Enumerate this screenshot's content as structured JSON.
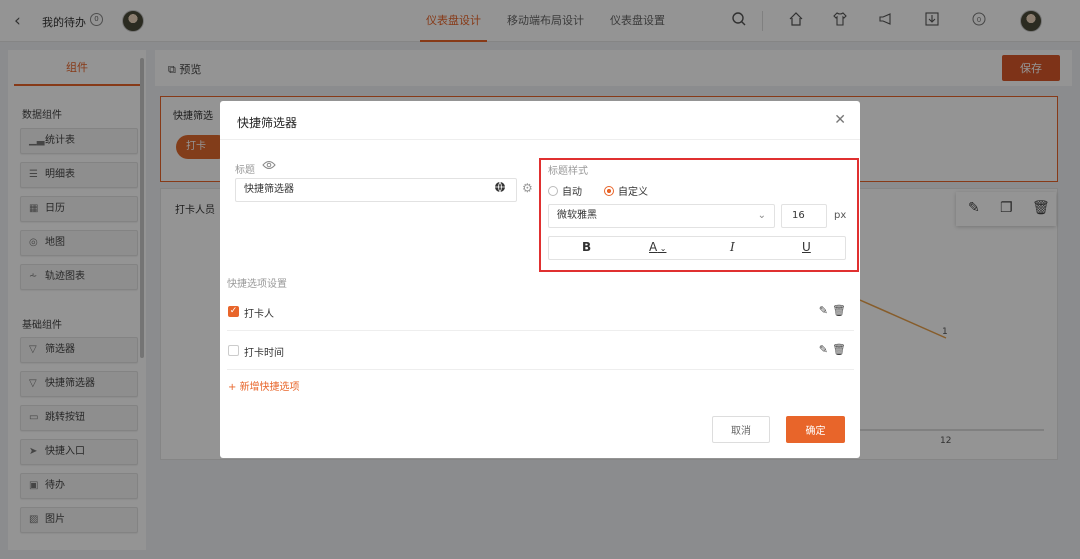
{
  "topbar": {
    "back_icon": "chevron-left-icon",
    "todo_title": "我的待办",
    "todo_badge": "0",
    "tabs": [
      "仪表盘设计",
      "移动端布局设计",
      "仪表盘设置"
    ],
    "active_tab": 0,
    "icons": [
      "search-icon",
      "home-icon",
      "shirt-icon",
      "megaphone-icon",
      "download-icon",
      "notification-badge-icon"
    ],
    "notification_badge": "0"
  },
  "left_panel": {
    "tab_label": "组件",
    "data_group_label": "数据组件",
    "data_items": [
      "统计表",
      "明细表",
      "日历",
      "地图",
      "轨迹图表"
    ],
    "basic_group_label": "基础组件",
    "basic_items": [
      "筛选器",
      "快捷筛选器",
      "跳转按钮",
      "快捷入口",
      "待办",
      "图片"
    ]
  },
  "canvas": {
    "preview_label": "预览",
    "save_label": "保存",
    "widget1_title": "快捷筛选",
    "widget1_chip": "打卡",
    "widget2_title": "打卡人员",
    "chart_value_label": "1",
    "chart_axis_label": "12"
  },
  "dialog": {
    "title": "快捷筛选器",
    "title_label": "标题",
    "title_value": "快捷筛选器",
    "style_label": "标题样式",
    "radio_auto": "自动",
    "radio_custom": "自定义",
    "radio_selected": "custom",
    "font_family": "微软雅黑",
    "font_size": "16",
    "font_unit": "px",
    "format_buttons": [
      "B",
      "A",
      "I",
      "U"
    ],
    "quick_options_label": "快捷选项设置",
    "options": [
      {
        "label": "打卡人",
        "checked": true
      },
      {
        "label": "打卡时间",
        "checked": false
      }
    ],
    "add_option_label": "新增快捷选项",
    "cancel_label": "取消",
    "confirm_label": "确定"
  },
  "colors": {
    "accent": "#e8652a",
    "highlight_border": "#e03030",
    "save_button": "#d9592a"
  }
}
